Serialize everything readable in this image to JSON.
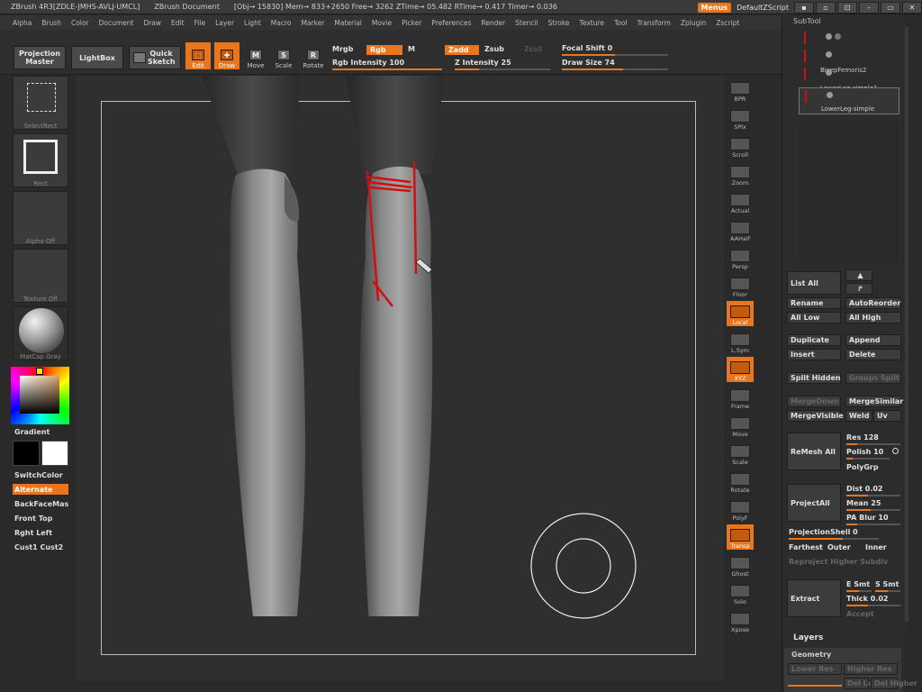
{
  "titlebar": {
    "app": "ZBrush 4R3[ZDLE-JMHS-AVLJ-UMCL]",
    "doc": "ZBrush Document",
    "stats": "[Obj→ 15830] Mem→ 833+2650 Free→ 3262 ZTime→ 05.482 RTime→ 0.417 Timer→ 0.036",
    "menus_btn": "Menus",
    "script": "DefaultZScript"
  },
  "menubar": [
    "Alpha",
    "Brush",
    "Color",
    "Document",
    "Draw",
    "Edit",
    "File",
    "Layer",
    "Light",
    "Macro",
    "Marker",
    "Material",
    "Movie",
    "Picker",
    "Preferences",
    "Render",
    "Stencil",
    "Stroke",
    "Texture",
    "Tool",
    "Transform",
    "Zplugin",
    "Zscript"
  ],
  "toolbar": {
    "projection_master": "Projection Master",
    "lightbox": "LightBox",
    "quick_sketch": "Quick Sketch",
    "edit": "Edit",
    "draw": "Draw",
    "move": "Move",
    "scale": "Scale",
    "rotate": "Rotate",
    "mrgb": "Mrgb",
    "rgb": "Rgb",
    "m": "M",
    "rgb_intensity": "Rgb Intensity 100",
    "zadd": "Zadd",
    "zsub": "Zsub",
    "zcut": "Zcut",
    "z_intensity": "Z Intensity 25",
    "focal_shift": "Focal Shift 0",
    "draw_size": "Draw Size 74"
  },
  "leftshelf": {
    "selectrect": "SelectRect",
    "rect": "Rect",
    "alpha_off": "Alpha Off",
    "texture_off": "Texture Off",
    "matcap": "MatCap Gray",
    "gradient": "Gradient",
    "switchcolor": "SwitchColor",
    "alternate": "Alternate",
    "backfacemask": "BackFaceMas",
    "front_top": "Front Top",
    "right_left": "Rght Left",
    "cust": "Cust1 Cust2"
  },
  "rightshelf": [
    "BPR",
    "SPix",
    "Scroll",
    "Zoom",
    "Actual",
    "AAHalf",
    "Persp",
    "Floor",
    "Local",
    "L.Sym",
    "XYZ",
    "Frame",
    "Move",
    "Scale",
    "Rotate",
    "PolyF",
    "Transp",
    "Ghost",
    "Solo",
    "Xpose"
  ],
  "panel": {
    "title": "SubTool",
    "subtools": [
      "BicepFemoris2",
      "LowerLeg-simple1",
      "LowerLeg-simple"
    ],
    "list_all": "List All",
    "rename": "Rename",
    "autoreorder": "AutoReorder",
    "all_low": "All Low",
    "all_high": "All High",
    "duplicate": "Duplicate",
    "append": "Append",
    "insert": "Insert",
    "delete": "Delete",
    "split_hidden": "Split Hidden",
    "groups_split": "Groups Split",
    "mergedown": "MergeDown",
    "mergesimilar": "MergeSimilar",
    "mergevisible": "MergeVisible",
    "weld": "Weld",
    "uv": "Uv",
    "remesh_all": "ReMesh All",
    "res": "Res 128",
    "polish": "Polish 10",
    "polygrp": "PolyGrp",
    "project_all": "ProjectAll",
    "dist": "Dist 0.02",
    "mean": "Mean 25",
    "pa_blur": "PA Blur 10",
    "projection_shell": "ProjectionShell 0",
    "farthest": "Farthest",
    "outer": "Outer",
    "inner": "Inner",
    "reproject": "Reproject Higher Subdiv",
    "extract": "Extract",
    "e_smt": "E Smt",
    "s_smt": "S Smt",
    "thick": "Thick 0.02",
    "accept": "Accept",
    "layers": "Layers",
    "geometry": "Geometry",
    "lower_res": "Lower Res",
    "higher_res": "Higher Res",
    "sdiv": "SDiv",
    "dellower": "Del Lower",
    "delhigher": "Del Higher"
  }
}
